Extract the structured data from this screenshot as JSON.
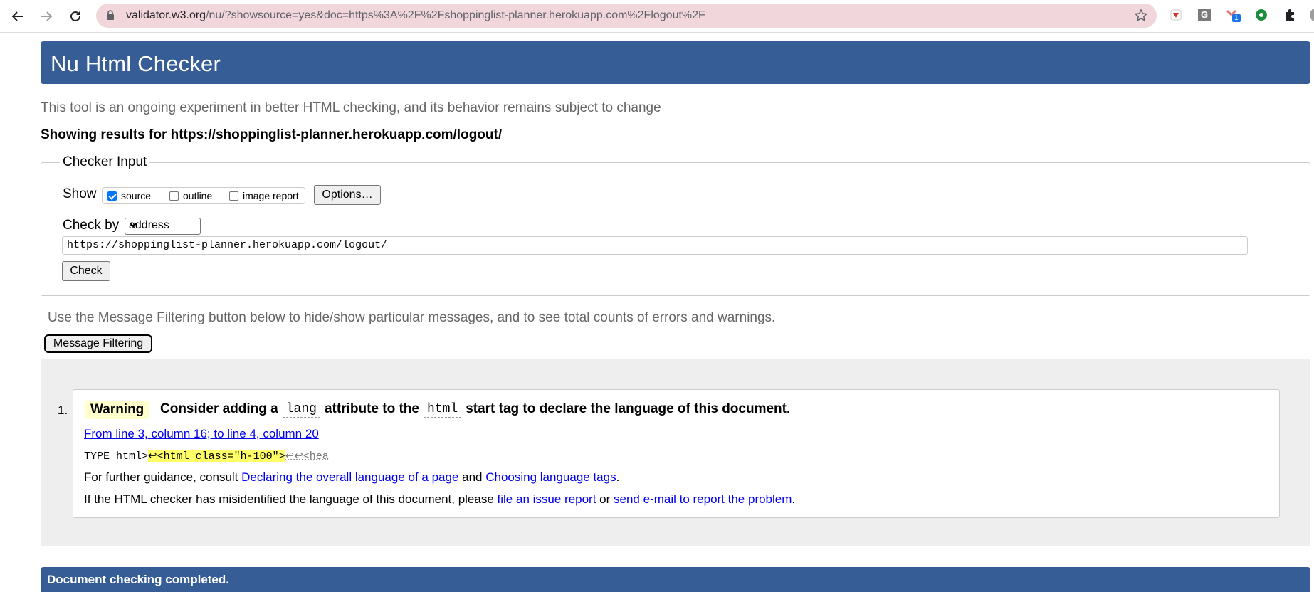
{
  "browser": {
    "url_host": "validator.w3.org",
    "url_rest": "/nu/?showsource=yes&doc=https%3A%2F%2Fshoppinglist-planner.herokuapp.com%2Flogout%2F",
    "ext_badge": "1",
    "ext_g_letter": "G",
    "icons": [
      "back-arrow-icon",
      "forward-arrow-icon",
      "reload-icon",
      "lock-icon",
      "star-icon",
      "extension-icons",
      "puzzle-icon",
      "avatar"
    ]
  },
  "page": {
    "title": "Nu Html Checker",
    "intro": "This tool is an ongoing experiment in better HTML checking, and its behavior remains subject to change",
    "results_prefix": "Showing results for ",
    "results_url": "https://shoppinglist-planner.herokuapp.com/logout/",
    "checker_input": {
      "legend": "Checker Input",
      "show_label": "Show",
      "options": [
        {
          "label": "source",
          "checked": true
        },
        {
          "label": "outline",
          "checked": false
        },
        {
          "label": "image report",
          "checked": false
        }
      ],
      "options_button": "Options…",
      "check_by_label": "Check by",
      "check_by_value": "address",
      "url_value": "https://shoppinglist-planner.herokuapp.com/logout/",
      "check_button": "Check"
    },
    "filter_hint": "Use the Message Filtering button below to hide/show particular messages, and to see total counts of errors and warnings.",
    "filter_button": "Message Filtering",
    "messages": [
      {
        "number": "1.",
        "type": "Warning",
        "text_part1": "Consider adding a",
        "code1": "lang",
        "text_part2": "attribute to the",
        "code2": "html",
        "text_part3": "start tag to declare the language of this document.",
        "location": "From line 3, column 16; to line 4, column 20",
        "extract_pre": "TYPE html>",
        "extract_hl": "↩<html class=\"h-100\">",
        "extract_post": "↩↩<hea",
        "guidance_prefix": "For further guidance, consult ",
        "guidance_link1": "Declaring the overall language of a page",
        "guidance_and": " and ",
        "guidance_link2": "Choosing language tags",
        "guidance_end": ".",
        "misid_prefix": "If the HTML checker has misidentified the language of this document, please ",
        "misid_link1": "file an issue report",
        "misid_or": " or ",
        "misid_link2": "send e-mail to report the problem",
        "misid_end": "."
      }
    ],
    "done": "Document checking completed."
  },
  "colors": {
    "banner": "#365d95",
    "omnibox": "#f1d6dc",
    "results_bg": "#eeeeee",
    "warning_bg": "#ffffcc",
    "highlight": "#ffff66",
    "link": "#0000ee"
  }
}
